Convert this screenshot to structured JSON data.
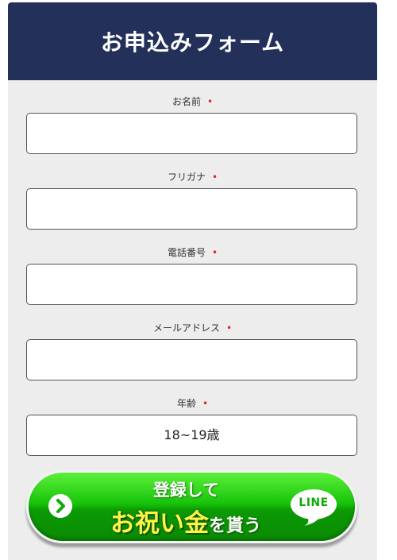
{
  "form": {
    "title": "お申込みフォーム",
    "required_mark": "•",
    "fields": [
      {
        "label": "お名前",
        "value": ""
      },
      {
        "label": "フリガナ",
        "value": ""
      },
      {
        "label": "電話番号",
        "value": ""
      },
      {
        "label": "メールアドレス",
        "value": ""
      },
      {
        "label": "年齢",
        "value": "18~19歳"
      }
    ]
  },
  "cta": {
    "line1": "登録して",
    "emphasis": "お祝い金",
    "suffix": "を貰う",
    "badge": "LINE"
  },
  "colors": {
    "header_bg": "#23305a",
    "card_bg": "#ededed",
    "required": "#e0202a",
    "cta_green": "#17c40a",
    "cta_yellow": "#fff34a"
  }
}
